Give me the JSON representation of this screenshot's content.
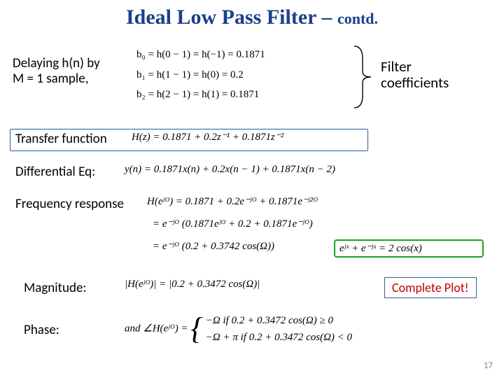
{
  "title_main": "Ideal Low Pass Filter – ",
  "title_contd": "contd.",
  "delay_note_l1": "Delaying h(n) by",
  "delay_note_l2": "M = 1 sample,",
  "coef": {
    "b0": "b₀ = h(0 − 1) = h(−1) = 0.1871",
    "b1": "b₁ = h(1 − 1) = h(0) = 0.2",
    "b2": "b₂ = h(2 − 1) = h(1) = 0.1871"
  },
  "coef_label_l1": "Filter",
  "coef_label_l2": "coefficients",
  "tf_label": "Transfer function",
  "tf_eq": "H(z) = 0.1871 + 0.2z⁻¹ + 0.1871z⁻²",
  "diff_label": "Differential Eq:",
  "diff_eq": "y(n) = 0.1871x(n) + 0.2x(n − 1) + 0.1871x(n − 2)",
  "fr_label": "Frequency response",
  "fr_eq1": "H(eʲᴼ) = 0.1871 + 0.2e⁻ʲᴼ + 0.1871e⁻ʲ²ᴼ",
  "fr_eq2": "= e⁻ʲᴼ (0.1871eʲᴼ + 0.2 + 0.1871e⁻ʲᴼ)",
  "fr_eq3": "= e⁻ʲᴼ (0.2 + 0.3742 cos(Ω))",
  "identity": "eʲˣ + e⁻ʲˣ = 2 cos(x)",
  "mag_label": "Magnitude:",
  "mag_eq": "|H(eʲᴼ)| = |0.2 + 0.3472 cos(Ω)|",
  "complete": "Complete Plot!",
  "phase_label": "Phase:",
  "phase_and": "and  ∠H(eʲᴼ) = ",
  "phase_case1": "−Ω        if 0.2 + 0.3472 cos(Ω) ≥ 0",
  "phase_case2": "−Ω + π   if 0.2 + 0.3472 cos(Ω) < 0",
  "pagenum": "17"
}
